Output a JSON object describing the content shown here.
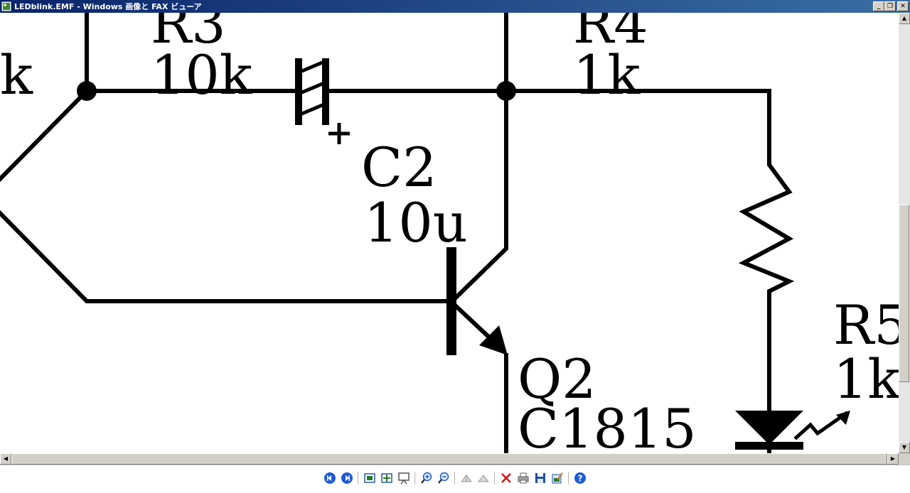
{
  "window": {
    "title": "LEDblink.EMF - Windows 画像と FAX ビューア",
    "minimize_glyph": "_",
    "restore_glyph": "❐",
    "close_glyph": "✕"
  },
  "schematic": {
    "partial_label_left": "k",
    "r3": {
      "ref": "R3",
      "value": "10k"
    },
    "r4": {
      "ref": "R4",
      "value": "1k"
    },
    "c2": {
      "ref": "C2",
      "value": "10u",
      "polarity": "+"
    },
    "q2": {
      "ref": "Q2",
      "value": "C1815"
    },
    "r5": {
      "ref": "R5",
      "value": "1k"
    }
  },
  "scrollbars": {
    "up_glyph": "▲",
    "down_glyph": "▼",
    "left_glyph": "◀",
    "right_glyph": "▶"
  },
  "toolbar": {
    "buttons": [
      {
        "name": "previous-image-button",
        "icon": "previous-icon",
        "color": "#1e5bd8"
      },
      {
        "name": "next-image-button",
        "icon": "next-icon",
        "color": "#1e5bd8"
      },
      {
        "name": "best-fit-button",
        "icon": "best-fit-icon",
        "color": "#2a7a2a"
      },
      {
        "name": "actual-size-button",
        "icon": "actual-size-icon",
        "color": "#2a7a2a"
      },
      {
        "name": "slideshow-button",
        "icon": "slideshow-icon",
        "color": "#555555"
      },
      {
        "name": "zoom-in-button",
        "icon": "zoom-in-icon",
        "color": "#1e5bd8"
      },
      {
        "name": "zoom-out-button",
        "icon": "zoom-out-icon",
        "color": "#1e5bd8"
      },
      {
        "name": "rotate-clockwise-button",
        "icon": "rotate-cw-icon",
        "color": "#9a9a9a"
      },
      {
        "name": "rotate-counterclockwise-button",
        "icon": "rotate-ccw-icon",
        "color": "#9a9a9a"
      },
      {
        "name": "delete-button",
        "icon": "delete-icon",
        "color": "#d01010"
      },
      {
        "name": "print-button",
        "icon": "print-icon",
        "color": "#606060"
      },
      {
        "name": "save-button",
        "icon": "save-icon",
        "color": "#1e4fa8"
      },
      {
        "name": "edit-button",
        "icon": "edit-icon",
        "color": "#2a7a2a"
      },
      {
        "name": "help-button",
        "icon": "help-icon",
        "color": "#1e5bd8"
      }
    ]
  }
}
